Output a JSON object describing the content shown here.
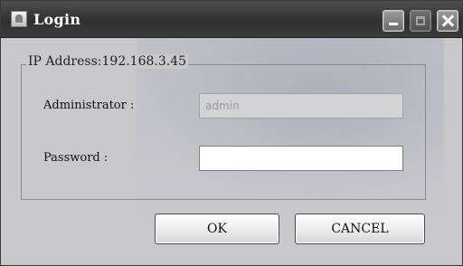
{
  "window": {
    "title": "Login",
    "controls": {
      "minimize": "minimize-icon",
      "maximize": "maximize-icon",
      "close": "close-icon"
    }
  },
  "group": {
    "legend": "IP Address:192.168.3.45"
  },
  "form": {
    "administrator_label": "Administrator :",
    "administrator_value": "admin",
    "password_label": "Password :",
    "password_value": ""
  },
  "buttons": {
    "ok": "OK",
    "cancel": "CANCEL"
  },
  "colors": {
    "titlebar": "#2f2f2f",
    "dialog_bg": "#c9c9cc",
    "field_disabled_bg": "#d3d3d5"
  }
}
